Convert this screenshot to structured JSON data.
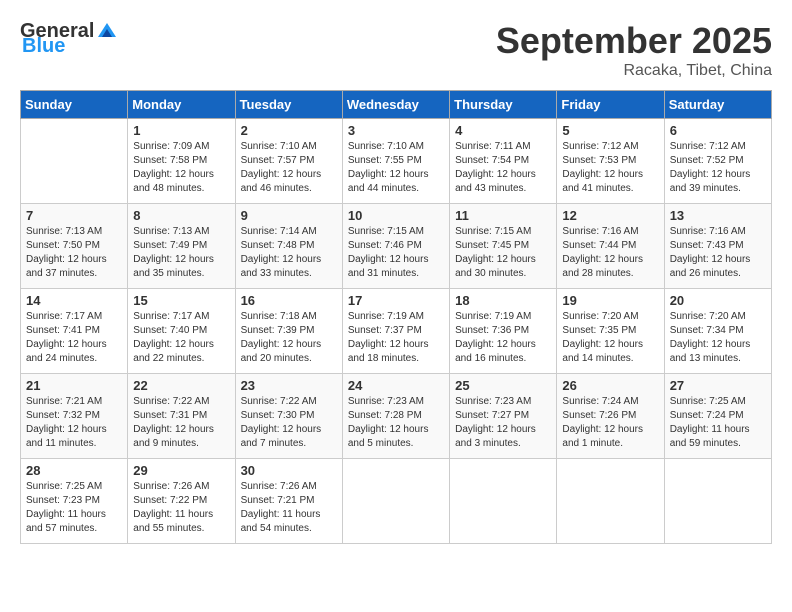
{
  "header": {
    "logo_general": "General",
    "logo_blue": "Blue",
    "month_title": "September 2025",
    "location": "Racaka, Tibet, China"
  },
  "days_of_week": [
    "Sunday",
    "Monday",
    "Tuesday",
    "Wednesday",
    "Thursday",
    "Friday",
    "Saturday"
  ],
  "weeks": [
    [
      {
        "day": "",
        "info": ""
      },
      {
        "day": "1",
        "info": "Sunrise: 7:09 AM\nSunset: 7:58 PM\nDaylight: 12 hours\nand 48 minutes."
      },
      {
        "day": "2",
        "info": "Sunrise: 7:10 AM\nSunset: 7:57 PM\nDaylight: 12 hours\nand 46 minutes."
      },
      {
        "day": "3",
        "info": "Sunrise: 7:10 AM\nSunset: 7:55 PM\nDaylight: 12 hours\nand 44 minutes."
      },
      {
        "day": "4",
        "info": "Sunrise: 7:11 AM\nSunset: 7:54 PM\nDaylight: 12 hours\nand 43 minutes."
      },
      {
        "day": "5",
        "info": "Sunrise: 7:12 AM\nSunset: 7:53 PM\nDaylight: 12 hours\nand 41 minutes."
      },
      {
        "day": "6",
        "info": "Sunrise: 7:12 AM\nSunset: 7:52 PM\nDaylight: 12 hours\nand 39 minutes."
      }
    ],
    [
      {
        "day": "7",
        "info": "Sunrise: 7:13 AM\nSunset: 7:50 PM\nDaylight: 12 hours\nand 37 minutes."
      },
      {
        "day": "8",
        "info": "Sunrise: 7:13 AM\nSunset: 7:49 PM\nDaylight: 12 hours\nand 35 minutes."
      },
      {
        "day": "9",
        "info": "Sunrise: 7:14 AM\nSunset: 7:48 PM\nDaylight: 12 hours\nand 33 minutes."
      },
      {
        "day": "10",
        "info": "Sunrise: 7:15 AM\nSunset: 7:46 PM\nDaylight: 12 hours\nand 31 minutes."
      },
      {
        "day": "11",
        "info": "Sunrise: 7:15 AM\nSunset: 7:45 PM\nDaylight: 12 hours\nand 30 minutes."
      },
      {
        "day": "12",
        "info": "Sunrise: 7:16 AM\nSunset: 7:44 PM\nDaylight: 12 hours\nand 28 minutes."
      },
      {
        "day": "13",
        "info": "Sunrise: 7:16 AM\nSunset: 7:43 PM\nDaylight: 12 hours\nand 26 minutes."
      }
    ],
    [
      {
        "day": "14",
        "info": "Sunrise: 7:17 AM\nSunset: 7:41 PM\nDaylight: 12 hours\nand 24 minutes."
      },
      {
        "day": "15",
        "info": "Sunrise: 7:17 AM\nSunset: 7:40 PM\nDaylight: 12 hours\nand 22 minutes."
      },
      {
        "day": "16",
        "info": "Sunrise: 7:18 AM\nSunset: 7:39 PM\nDaylight: 12 hours\nand 20 minutes."
      },
      {
        "day": "17",
        "info": "Sunrise: 7:19 AM\nSunset: 7:37 PM\nDaylight: 12 hours\nand 18 minutes."
      },
      {
        "day": "18",
        "info": "Sunrise: 7:19 AM\nSunset: 7:36 PM\nDaylight: 12 hours\nand 16 minutes."
      },
      {
        "day": "19",
        "info": "Sunrise: 7:20 AM\nSunset: 7:35 PM\nDaylight: 12 hours\nand 14 minutes."
      },
      {
        "day": "20",
        "info": "Sunrise: 7:20 AM\nSunset: 7:34 PM\nDaylight: 12 hours\nand 13 minutes."
      }
    ],
    [
      {
        "day": "21",
        "info": "Sunrise: 7:21 AM\nSunset: 7:32 PM\nDaylight: 12 hours\nand 11 minutes."
      },
      {
        "day": "22",
        "info": "Sunrise: 7:22 AM\nSunset: 7:31 PM\nDaylight: 12 hours\nand 9 minutes."
      },
      {
        "day": "23",
        "info": "Sunrise: 7:22 AM\nSunset: 7:30 PM\nDaylight: 12 hours\nand 7 minutes."
      },
      {
        "day": "24",
        "info": "Sunrise: 7:23 AM\nSunset: 7:28 PM\nDaylight: 12 hours\nand 5 minutes."
      },
      {
        "day": "25",
        "info": "Sunrise: 7:23 AM\nSunset: 7:27 PM\nDaylight: 12 hours\nand 3 minutes."
      },
      {
        "day": "26",
        "info": "Sunrise: 7:24 AM\nSunset: 7:26 PM\nDaylight: 12 hours\nand 1 minute."
      },
      {
        "day": "27",
        "info": "Sunrise: 7:25 AM\nSunset: 7:24 PM\nDaylight: 11 hours\nand 59 minutes."
      }
    ],
    [
      {
        "day": "28",
        "info": "Sunrise: 7:25 AM\nSunset: 7:23 PM\nDaylight: 11 hours\nand 57 minutes."
      },
      {
        "day": "29",
        "info": "Sunrise: 7:26 AM\nSunset: 7:22 PM\nDaylight: 11 hours\nand 55 minutes."
      },
      {
        "day": "30",
        "info": "Sunrise: 7:26 AM\nSunset: 7:21 PM\nDaylight: 11 hours\nand 54 minutes."
      },
      {
        "day": "",
        "info": ""
      },
      {
        "day": "",
        "info": ""
      },
      {
        "day": "",
        "info": ""
      },
      {
        "day": "",
        "info": ""
      }
    ]
  ]
}
